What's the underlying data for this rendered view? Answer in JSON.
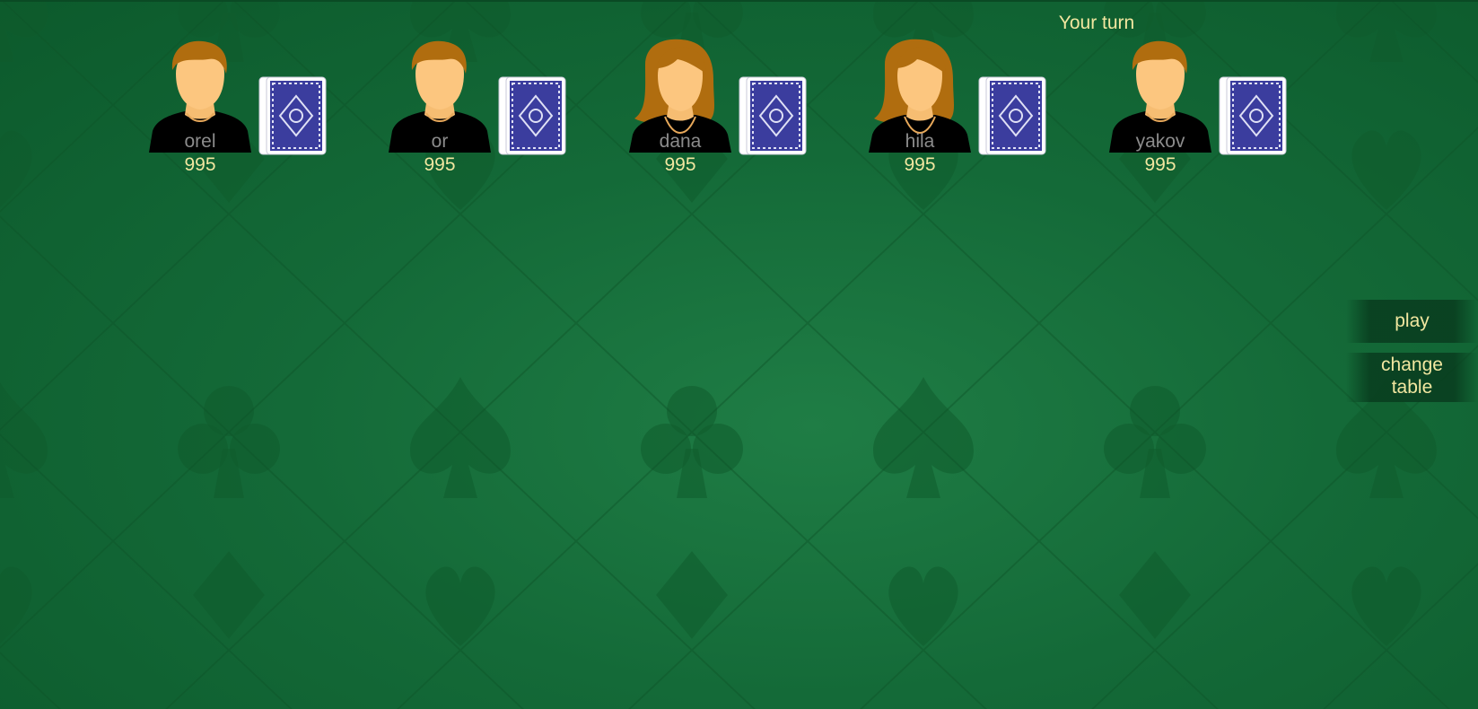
{
  "turn_label": "Your turn",
  "players": [
    {
      "name": "orel",
      "chips": "995",
      "avatar": "male-avatar-icon"
    },
    {
      "name": "or",
      "chips": "995",
      "avatar": "male-avatar-icon"
    },
    {
      "name": "dana",
      "chips": "995",
      "avatar": "female-avatar-icon"
    },
    {
      "name": "hila",
      "chips": "995",
      "avatar": "female-avatar-icon"
    },
    {
      "name": "yakov",
      "chips": "995",
      "avatar": "male-avatar-icon"
    }
  ],
  "buttons": {
    "play": "play",
    "change_table": "change table"
  },
  "colors": {
    "felt": "#146a38",
    "label_text": "#f2e7a0",
    "name_text": "#8c8c8c",
    "hair": "#b06d0f",
    "skin": "#fcc67f",
    "card_back": "#3b3d9e"
  }
}
